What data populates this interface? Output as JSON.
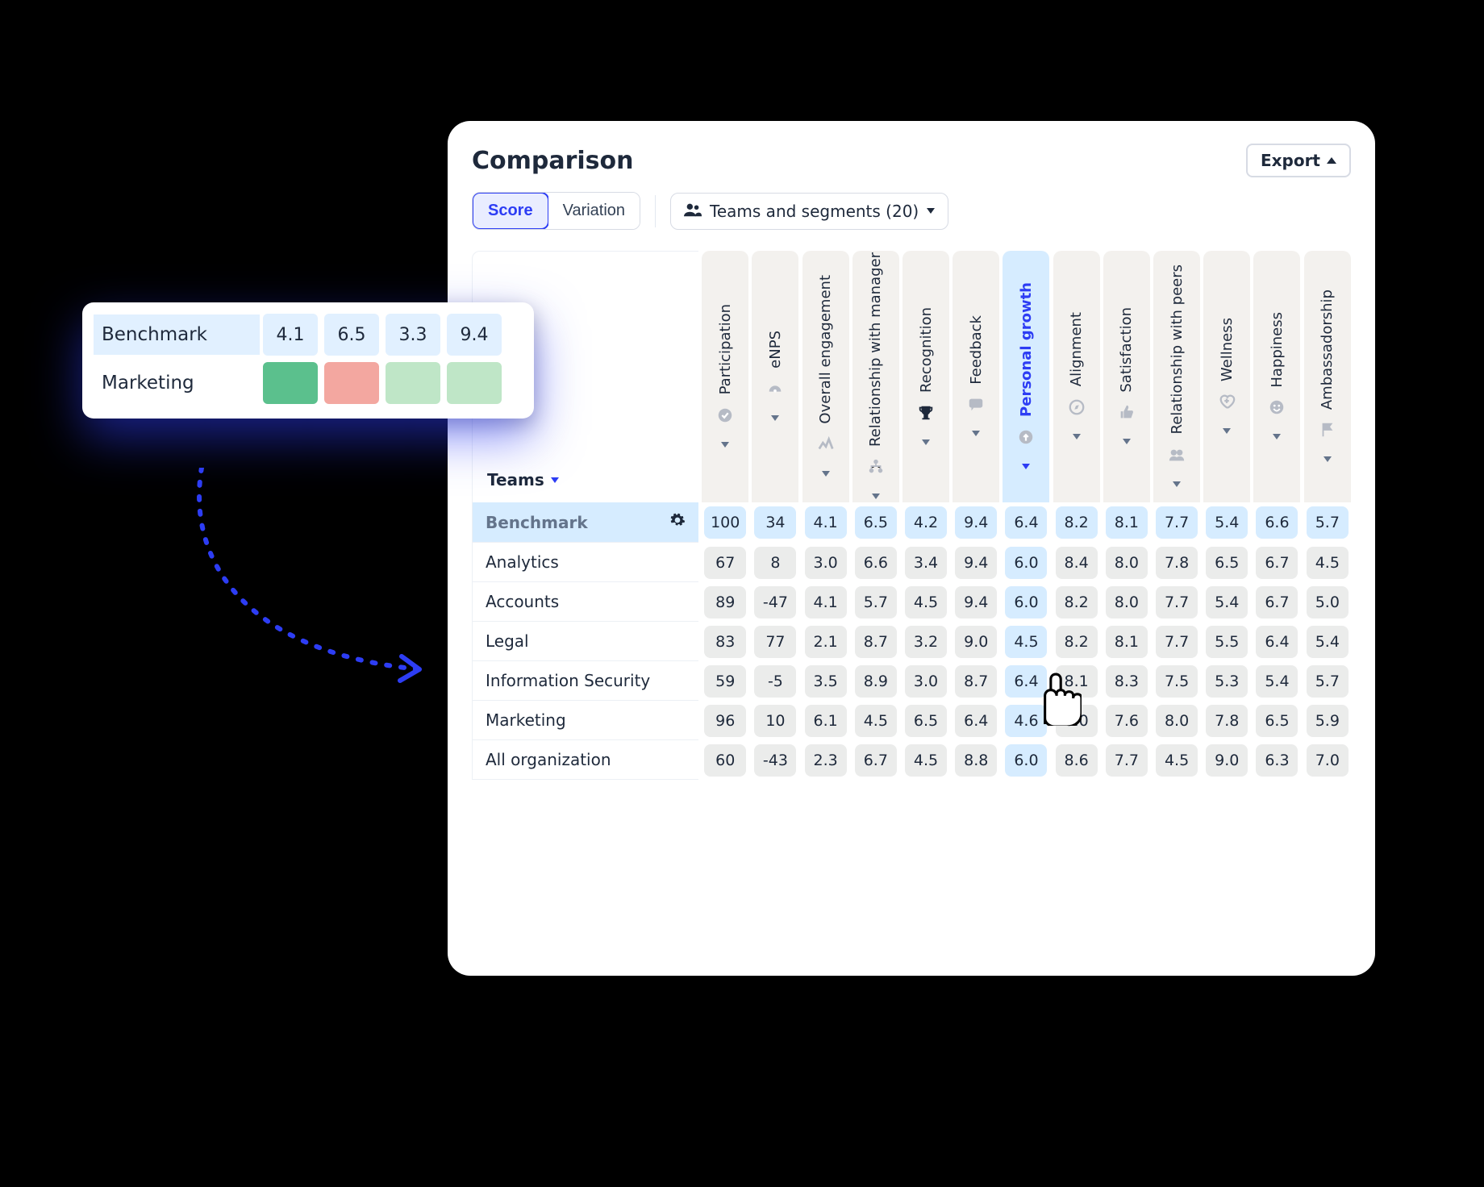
{
  "header": {
    "title": "Comparison",
    "export_label": "Export"
  },
  "toolbar": {
    "tab_score": "Score",
    "tab_variation": "Variation",
    "filter_label": "Teams and segments (20)"
  },
  "table": {
    "teams_label": "Teams",
    "columns": [
      {
        "label": "Participation",
        "icon": "check-circle"
      },
      {
        "label": "eNPS",
        "icon": "gauge"
      },
      {
        "label": "Overall engagement",
        "icon": "spark"
      },
      {
        "label": "Relationship with manager",
        "icon": "hierarchy"
      },
      {
        "label": "Recognition",
        "icon": "trophy",
        "dark": true
      },
      {
        "label": "Feedback",
        "icon": "chat"
      },
      {
        "label": "Personal growth",
        "icon": "growth",
        "highlight": true
      },
      {
        "label": "Alignment",
        "icon": "compass"
      },
      {
        "label": "Satisfaction",
        "icon": "thumb"
      },
      {
        "label": "Relationship with peers",
        "icon": "peers"
      },
      {
        "label": "Wellness",
        "icon": "heart"
      },
      {
        "label": "Happiness",
        "icon": "smile"
      },
      {
        "label": "Ambassadorship",
        "icon": "flag"
      }
    ],
    "rows": [
      {
        "label": "Benchmark",
        "benchmark": true,
        "values": [
          "100",
          "34",
          "4.1",
          "6.5",
          "4.2",
          "9.4",
          "6.4",
          "8.2",
          "8.1",
          "7.7",
          "5.4",
          "6.6",
          "5.7"
        ]
      },
      {
        "label": "Analytics",
        "values": [
          "67",
          "8",
          "3.0",
          "6.6",
          "3.4",
          "9.4",
          "6.0",
          "8.4",
          "8.0",
          "7.8",
          "6.5",
          "6.7",
          "4.5"
        ]
      },
      {
        "label": "Accounts",
        "values": [
          "89",
          "-47",
          "4.1",
          "5.7",
          "4.5",
          "9.4",
          "6.0",
          "8.2",
          "8.0",
          "7.7",
          "5.4",
          "6.7",
          "5.0"
        ]
      },
      {
        "label": "Legal",
        "values": [
          "83",
          "77",
          "2.1",
          "8.7",
          "3.2",
          "9.0",
          "4.5",
          "8.2",
          "8.1",
          "7.7",
          "5.5",
          "6.4",
          "5.4"
        ]
      },
      {
        "label": "Information Security",
        "values": [
          "59",
          "-5",
          "3.5",
          "8.9",
          "3.0",
          "8.7",
          "6.4",
          "8.1",
          "8.3",
          "7.5",
          "5.3",
          "5.4",
          "5.7"
        ]
      },
      {
        "label": "Marketing",
        "values": [
          "96",
          "10",
          "6.1",
          "4.5",
          "6.5",
          "6.4",
          "4.6",
          "8.0",
          "7.6",
          "8.0",
          "7.8",
          "6.5",
          "5.9"
        ]
      },
      {
        "label": "All organization",
        "values": [
          "60",
          "-43",
          "2.3",
          "6.7",
          "4.5",
          "8.8",
          "6.0",
          "8.6",
          "7.7",
          "4.5",
          "9.0",
          "6.3",
          "7.0"
        ]
      }
    ]
  },
  "callout": {
    "row1_label": "Benchmark",
    "row1_values": [
      "4.1",
      "6.5",
      "3.3",
      "9.4"
    ],
    "row2_label": "Marketing",
    "row2_swatches": [
      "sw-g",
      "sw-r",
      "sw-lg",
      "sw-lg"
    ]
  }
}
